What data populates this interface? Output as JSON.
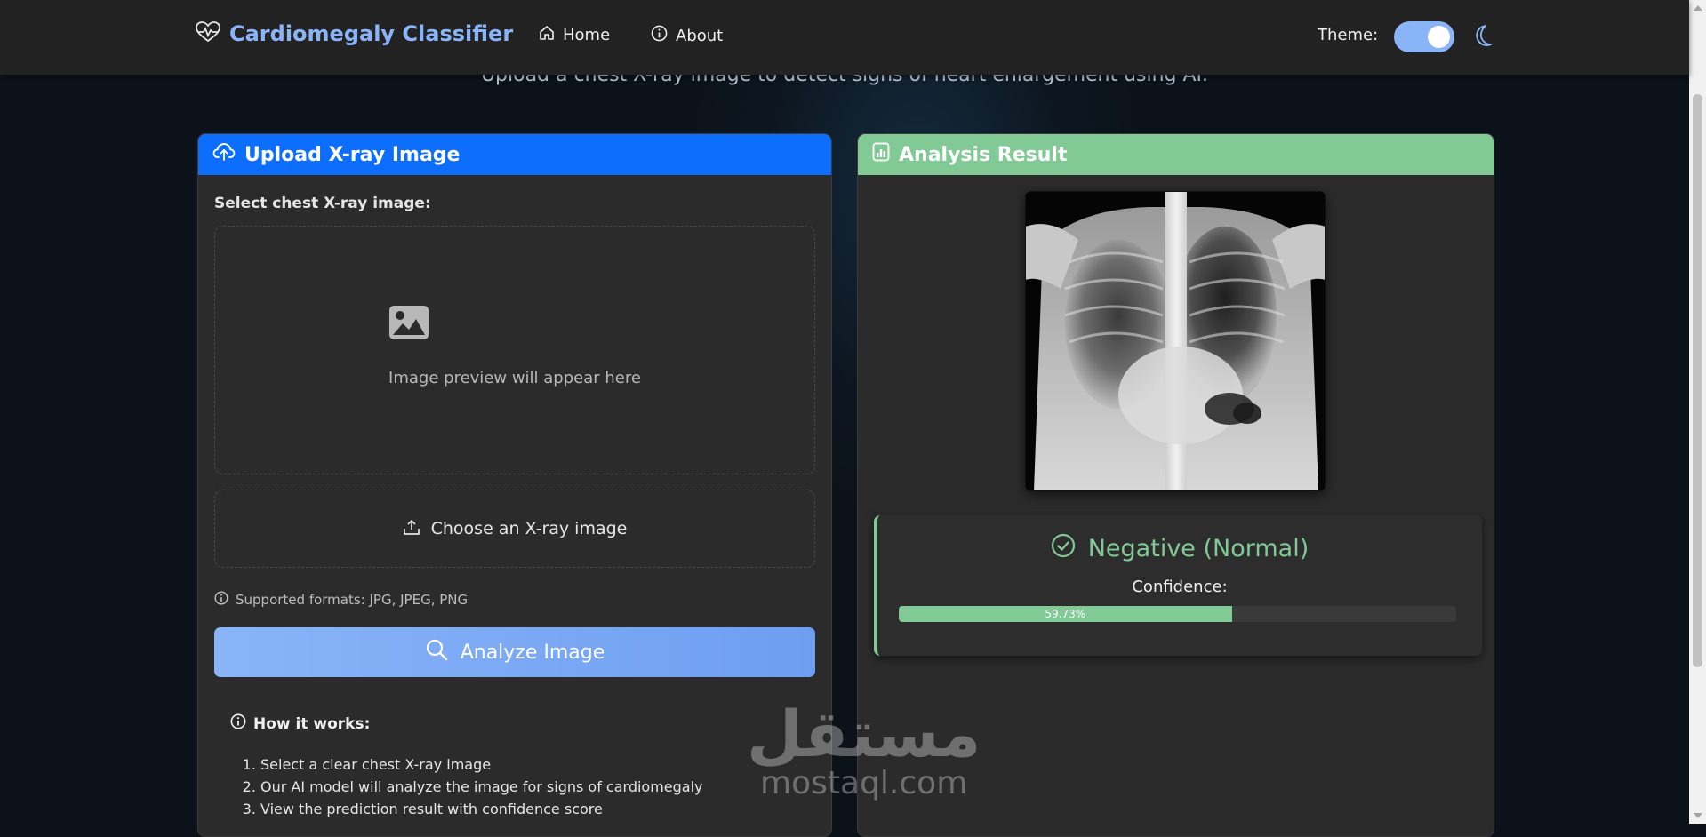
{
  "navbar": {
    "brand": "Cardiomegaly Classifier",
    "home_label": "Home",
    "about_label": "About",
    "theme_label": "Theme:",
    "theme_dark_enabled": true
  },
  "subtitle": "Upload a chest X-ray image to detect signs of heart enlargement using AI.",
  "upload_card": {
    "title": "Upload X-ray Image",
    "field_label": "Select chest X-ray image:",
    "preview_placeholder": "Image preview will appear here",
    "choose_label": "Choose an X-ray image",
    "formats_text": "Supported formats: JPG, JPEG, PNG",
    "analyze_label": "Analyze Image",
    "how_title": "How it works:",
    "steps": [
      "Select a clear chest X-ray image",
      "Our AI model will analyze the image for signs of cardiomegaly",
      "View the prediction result with confidence score"
    ]
  },
  "result_card": {
    "title": "Analysis Result",
    "prediction": "Negative (Normal)",
    "confidence_label": "Confidence:",
    "confidence_text": "59.73%",
    "confidence_value": 59.73
  },
  "watermark": {
    "arabic": "مستقل",
    "latin": "mostaql.com"
  },
  "colors": {
    "brand": "#8ab4f8",
    "upload_header": "#0d6efd",
    "result_header": "#81c995",
    "card_bg": "#2b2b2b",
    "page_bg": "#0c1219"
  },
  "icons": {
    "brand": "heart-pulse-icon",
    "home": "house-icon",
    "about": "info-circle-icon",
    "theme": "moon-icon",
    "upload_header": "cloud-upload-icon",
    "preview": "image-icon",
    "choose": "upload-icon",
    "formats": "info-circle-icon",
    "analyze": "search-icon",
    "result_header": "bar-chart-icon",
    "prediction": "check-circle-icon"
  }
}
